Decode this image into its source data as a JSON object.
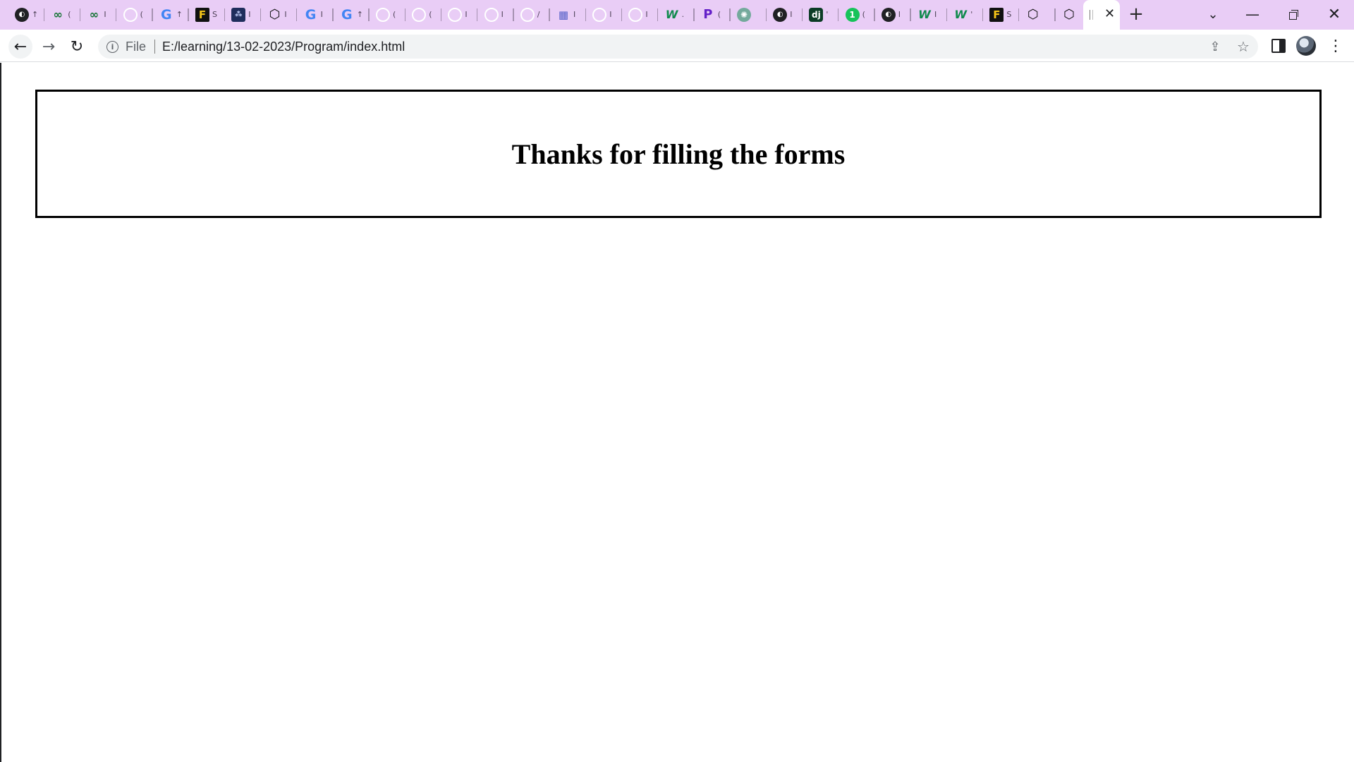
{
  "browser": {
    "tabs": [
      {
        "icon": "circle-dark",
        "glyph": "◐",
        "tail": "↑"
      },
      {
        "icon": "infinity",
        "glyph": "∞",
        "tail": "("
      },
      {
        "icon": "infinity",
        "glyph": "∞",
        "tail": "I"
      },
      {
        "icon": "github-icon",
        "glyph": "",
        "tail": "("
      },
      {
        "icon": "google",
        "glyph": "G",
        "tail": "↑"
      },
      {
        "icon": "f-logo",
        "glyph": "F",
        "tail": "S"
      },
      {
        "icon": "navy",
        "glyph": "⁂",
        "tail": "I"
      },
      {
        "icon": "cube",
        "glyph": "⬡",
        "tail": "I"
      },
      {
        "icon": "google",
        "glyph": "G",
        "tail": "I"
      },
      {
        "icon": "google",
        "glyph": "G",
        "tail": "↑"
      },
      {
        "icon": "github-icon",
        "glyph": "",
        "tail": "("
      },
      {
        "icon": "github-icon",
        "glyph": "",
        "tail": "("
      },
      {
        "icon": "github-icon",
        "glyph": "",
        "tail": "I"
      },
      {
        "icon": "github-icon",
        "glyph": "",
        "tail": "I"
      },
      {
        "icon": "github-icon",
        "glyph": "",
        "tail": "/"
      },
      {
        "icon": "pixel",
        "glyph": "▦",
        "tail": "I"
      },
      {
        "icon": "github-icon",
        "glyph": "",
        "tail": "I"
      },
      {
        "icon": "github-icon",
        "glyph": "",
        "tail": "I"
      },
      {
        "icon": "wix",
        "glyph": "W",
        "tail": "."
      },
      {
        "icon": "p-logo",
        "glyph": "P",
        "tail": "("
      },
      {
        "icon": "gpt",
        "glyph": "✺",
        "tail": ""
      },
      {
        "icon": "circle-dark",
        "glyph": "◐",
        "tail": "I"
      },
      {
        "icon": "dj",
        "glyph": "dj",
        "tail": "'"
      },
      {
        "icon": "one",
        "glyph": "1",
        "tail": "("
      },
      {
        "icon": "circle-dark",
        "glyph": "◐",
        "tail": "I"
      },
      {
        "icon": "wix",
        "glyph": "W",
        "tail": "I"
      },
      {
        "icon": "wix",
        "glyph": "W",
        "tail": "'"
      },
      {
        "icon": "f-logo",
        "glyph": "F",
        "tail": "S"
      },
      {
        "icon": "cube",
        "glyph": "⬡",
        "tail": ""
      },
      {
        "icon": "cube",
        "glyph": "⬡",
        "tail": ""
      }
    ],
    "active_tab_close": "✕",
    "new_tab": "+",
    "tab_search": "⌄",
    "minimize": "—",
    "close_window": "✕",
    "back": "←",
    "forward": "→",
    "reload": "↻",
    "address": {
      "info": "i",
      "scheme_label": "File",
      "url": "E:/learning/13-02-2023/Program/index.html"
    },
    "share": "⇪",
    "bookmark": "☆",
    "menu": "⋮"
  },
  "page": {
    "heading": "Thanks for filling the forms"
  }
}
